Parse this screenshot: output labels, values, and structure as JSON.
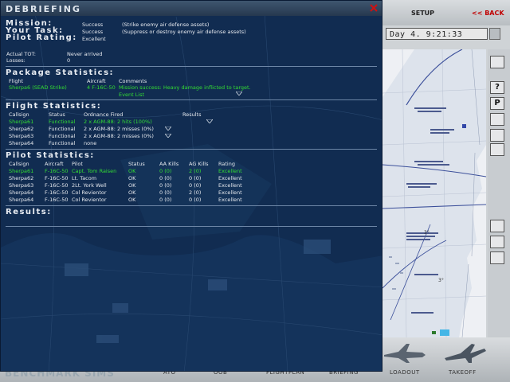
{
  "window": {
    "title": "DEBRIEFING"
  },
  "summary": {
    "mission_label": "Mission:",
    "mission_value": "Success",
    "mission_desc": "(Strike enemy air defense assets)",
    "task_label": "Your Task:",
    "task_value": "Success",
    "task_desc": "(Suppress or destroy enemy air defense assets)",
    "rating_label": "Pilot Rating:",
    "rating_value": "Excellent",
    "tot_label": "Actual TOT:",
    "tot_value": "Never arrived",
    "losses_label": "Losses:",
    "losses_value": "0"
  },
  "package": {
    "heading": "Package Statistics:",
    "columns": [
      "Flight",
      "Aircraft",
      "Comments"
    ],
    "row": {
      "flight": "Sherpa6 (SEAD Strike)",
      "aircraft": "4 F-16C-50",
      "comment": "Mission success: Heavy damage inflicted to target.",
      "event_list": "Event List"
    }
  },
  "flight": {
    "heading": "Flight Statistics:",
    "columns": [
      "Callsign",
      "Status",
      "Ordnance Fired",
      "Results"
    ],
    "rows": [
      {
        "callsign": "Sherpa61",
        "status": "Functional",
        "ordnance": "2 x AGM-88: 2 hits (100%)"
      },
      {
        "callsign": "Sherpa62",
        "status": "Functional",
        "ordnance": "2 x AGM-88: 2 misses (0%)"
      },
      {
        "callsign": "Sherpa63",
        "status": "Functional",
        "ordnance": "2 x AGM-88: 2 misses (0%)"
      },
      {
        "callsign": "Sherpa64",
        "status": "Functional",
        "ordnance": "none"
      }
    ]
  },
  "pilot": {
    "heading": "Pilot Statistics:",
    "columns": [
      "Callsign",
      "Aircraft",
      "Pilot",
      "Status",
      "AA Kills",
      "AG Kills",
      "Rating"
    ],
    "rows": [
      {
        "callsign": "Sherpa61",
        "aircraft": "F-16C-50",
        "pilot": "Capt. Tom Raisen",
        "status": "OK",
        "aa": "0 (0)",
        "ag": "2 (0)",
        "rating": "Excellent"
      },
      {
        "callsign": "Sherpa62",
        "aircraft": "F-16C-50",
        "pilot": "Lt. Tacom",
        "status": "OK",
        "aa": "0 (0)",
        "ag": "0 (0)",
        "rating": "Excellent"
      },
      {
        "callsign": "Sherpa63",
        "aircraft": "F-16C-50",
        "pilot": "2Lt. York Well",
        "status": "OK",
        "aa": "0 (0)",
        "ag": "0 (0)",
        "rating": "Excellent"
      },
      {
        "callsign": "Sherpa64",
        "aircraft": "F-16C-50",
        "pilot": "Col Revientor",
        "status": "OK",
        "aa": "0 (0)",
        "ag": "2 (0)",
        "rating": "Excellent"
      },
      {
        "callsign": "Sherpa64",
        "aircraft": "F-16C-50",
        "pilot": "Col Revientor",
        "status": "OK",
        "aa": "0 (0)",
        "ag": "0 (0)",
        "rating": "Excellent"
      }
    ]
  },
  "results": {
    "heading": "Results:"
  },
  "app": {
    "setup_tab": "SETUP",
    "back_tab": "<< BACK",
    "clock": "Day  4. 9:21:33",
    "bottom_tabs": [
      "ATO",
      "OOB",
      "FLIGHTPLAN",
      "BRIEFING",
      "LOADOUT",
      "TAKEOFF"
    ],
    "logo": "BENCHMARK SIMS",
    "tool_labels": [
      "?",
      "P"
    ]
  },
  "colors": {
    "window_bg": "#102a4e",
    "success_green": "#33dd33",
    "back_red": "#c00000",
    "close_red": "#d11111"
  }
}
